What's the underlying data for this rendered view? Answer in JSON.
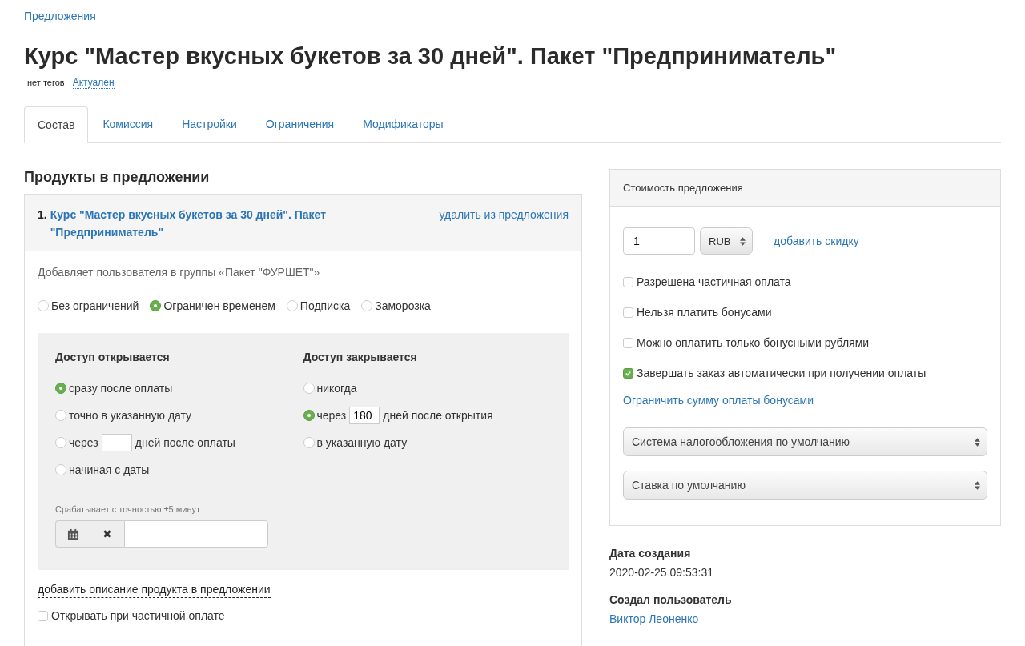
{
  "breadcrumb": "Предложения",
  "title": "Курс \"Мастер вкусных букетов за 30 дней\". Пакет \"Предприниматель\"",
  "tags": {
    "label": "нет тегов",
    "status": "Актуален"
  },
  "tabs": [
    {
      "label": "Состав",
      "selected": true
    },
    {
      "label": "Комиссия",
      "selected": false
    },
    {
      "label": "Настройки",
      "selected": false
    },
    {
      "label": "Ограничения",
      "selected": false
    },
    {
      "label": "Модификаторы",
      "selected": false
    }
  ],
  "products_title": "Продукты в предложении",
  "product": {
    "number": "1.",
    "name": "Курс \"Мастер вкусных букетов за 30 дней\". Пакет \"Предприниматель\"",
    "remove_link": "удалить из предложения",
    "groups_text": "Добавляет пользователя в группы «Пакет \"ФУРШЕТ\"»",
    "access_types": [
      {
        "label": "Без ограничений",
        "selected": false
      },
      {
        "label": "Ограничен временем",
        "selected": true
      },
      {
        "label": "Подписка",
        "selected": false
      },
      {
        "label": "Заморозка",
        "selected": false
      }
    ],
    "access_open": {
      "title": "Доступ открывается",
      "options": [
        {
          "kind": "plain",
          "label": "сразу после оплаты",
          "selected": true
        },
        {
          "kind": "plain",
          "label": "точно в указанную дату",
          "selected": false
        },
        {
          "kind": "days",
          "before": "через",
          "after": "дней после оплаты",
          "selected": false
        },
        {
          "kind": "plain",
          "label": "начиная с даты",
          "selected": false
        }
      ]
    },
    "access_close": {
      "title": "Доступ закрывается",
      "options": [
        {
          "kind": "plain",
          "label": "никогда",
          "selected": false
        },
        {
          "kind": "days",
          "before": "через",
          "value": "180",
          "after": "дней после открытия",
          "selected": true
        },
        {
          "kind": "plain",
          "label": "в указанную дату",
          "selected": false
        }
      ]
    },
    "precision_note": "Срабатывает с точностью ±5 минут",
    "clear_glyph": "✖",
    "description_link": "добавить описание продукта в предложении",
    "partial_open": {
      "label": "Открывать при частичной оплате",
      "checked": false
    }
  },
  "price": {
    "title": "Стоимость предложения",
    "amount": "1",
    "currency": "RUB",
    "discount_link": "добавить скидку",
    "options": [
      {
        "label": "Разрешена частичная оплата",
        "checked": false
      },
      {
        "label": "Нельзя платить бонусами",
        "checked": false
      },
      {
        "label": "Можно оплатить только бонусными рублями",
        "checked": false
      },
      {
        "label": "Завершать заказ автоматически при получении оплаты",
        "checked": true
      }
    ],
    "bonus_link": "Ограничить сумму оплаты бонусами",
    "selects": [
      "Система налогообложения по умолчанию",
      "Ставка по умолчанию"
    ]
  },
  "meta": [
    {
      "kind": "text",
      "label": "Дата создания",
      "value": "2020-02-25 09:53:31"
    },
    {
      "kind": "link",
      "label": "Создал пользователь",
      "value": "Виктор Леоненко"
    }
  ]
}
